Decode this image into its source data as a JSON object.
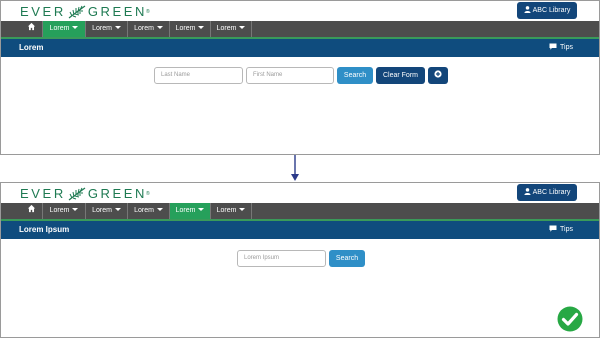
{
  "logo": {
    "text_a": "EVER",
    "text_b": "GREEN",
    "mark": "fern-leaf-icon",
    "tm": "®"
  },
  "library_button": {
    "label": "ABC Library",
    "icon": "person-icon"
  },
  "tips_label": "Tips",
  "panel1": {
    "nav": [
      {
        "icon": "home-icon"
      },
      {
        "label": "Lorem",
        "active": true
      },
      {
        "label": "Lorem",
        "active": false
      },
      {
        "label": "Lorem",
        "active": false
      },
      {
        "label": "Lorem",
        "active": false
      },
      {
        "label": "Lorem",
        "active": false
      }
    ],
    "title": "Lorem",
    "form": {
      "last_name_placeholder": "Last Name",
      "first_name_placeholder": "First Name",
      "search_label": "Search",
      "clear_label": "Clear Form",
      "add_icon": "plus-circle-icon"
    }
  },
  "panel2": {
    "nav": [
      {
        "icon": "home-icon"
      },
      {
        "label": "Lorem",
        "active": false
      },
      {
        "label": "Lorem",
        "active": false
      },
      {
        "label": "Lorem",
        "active": false
      },
      {
        "label": "Lorem",
        "active": true
      },
      {
        "label": "Lorem",
        "active": false
      }
    ],
    "title": "Lorem Ipsum",
    "form": {
      "search_placeholder": "Lorem Ipsum",
      "search_label": "Search"
    }
  },
  "colors": {
    "brand_green": "#1e7a52",
    "nav_bg": "#4d4d4d",
    "nav_active": "#26a05b",
    "title_bar": "#0f4c7e",
    "primary_button": "#2f8fc7",
    "dark_button": "#13467a",
    "success": "#27a844"
  },
  "decorations": {
    "transition_arrow": "down-arrow-icon",
    "success_mark": "check-circle-icon"
  }
}
